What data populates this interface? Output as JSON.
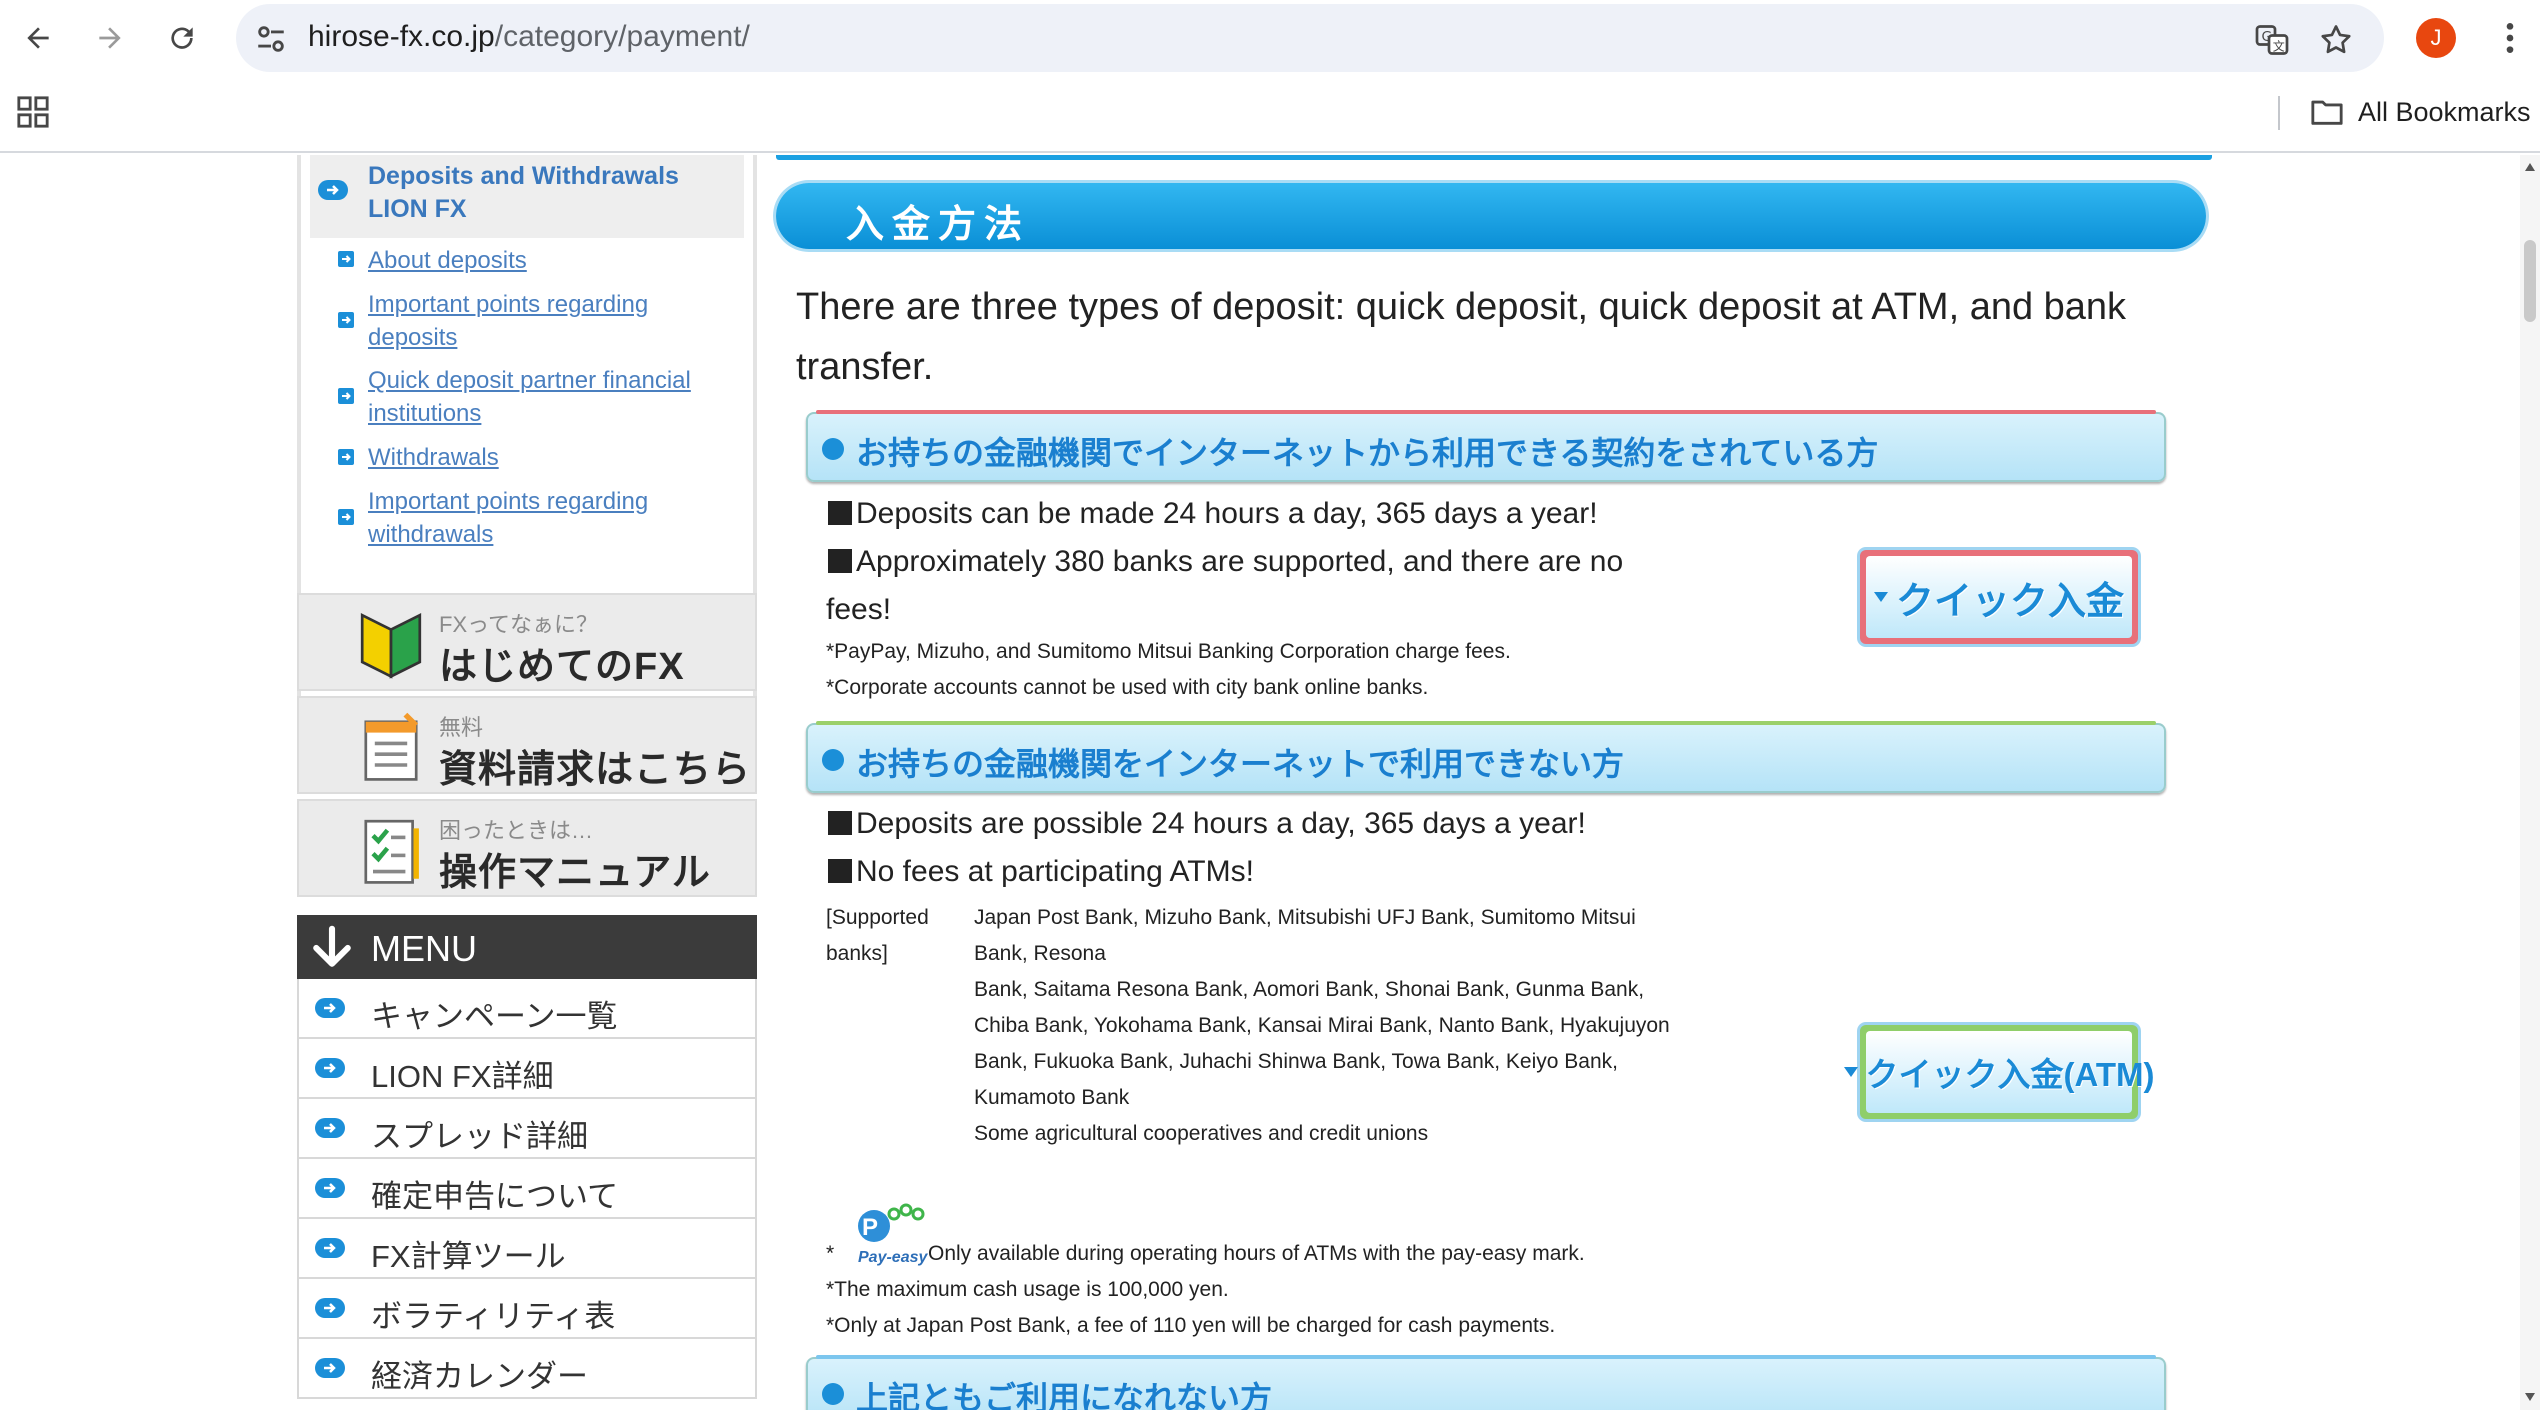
{
  "browser": {
    "url_host": "hirose-fx.co.jp",
    "url_path": "/category/payment/",
    "avatar_letter": "J",
    "bookmarks_label": "All Bookmarks"
  },
  "sidebar": {
    "active_heading": "Deposits and Withdrawals LION FX",
    "links": [
      "About deposits",
      "Important points regarding deposits",
      "Quick deposit partner financial institutions",
      "Withdrawals",
      "Important points regarding withdrawals"
    ],
    "banners": [
      {
        "small": "FXってなぁに？",
        "big": "はじめてのFX",
        "icon": "beginner-mark-icon"
      },
      {
        "small": "無料",
        "big": "資料請求はこちら",
        "icon": "document-request-icon"
      },
      {
        "small": "困ったときは…",
        "big": "操作マニュアル",
        "icon": "manual-checklist-icon"
      }
    ],
    "menu_title": "MENU",
    "menu_items": [
      "キャンペーン一覧",
      "LION FX詳細",
      "スプレッド詳細",
      "確定申告について",
      "FX計算ツール",
      "ボラティリティ表",
      "経済カレンダー"
    ]
  },
  "main": {
    "title": "入金方法",
    "intro": "There are three types of deposit: quick deposit, quick deposit at ATM, and bank transfer.",
    "section1": {
      "heading": "お持ちの金融機関でインターネットから利用できる契約をされている方",
      "line1": "Deposits can be made 24 hours a day, 365 days a year!",
      "line2a": "Approximately 380 banks are supported, and there are no",
      "line2b": "fees!",
      "note1": "*PayPay, Mizuho, and Sumitomo Mitsui Banking Corporation charge fees.",
      "note2": "*Corporate accounts cannot be used with city bank online banks.",
      "button": "クイック入金"
    },
    "section2": {
      "heading": "お持ちの金融機関をインターネットで利用できない方",
      "line1": "Deposits are possible 24 hours a day, 365 days a year!",
      "line2": "No fees at participating ATMs!",
      "banks_label": "[Supported banks]",
      "banks": [
        "Japan Post Bank, Mizuho Bank, Mitsubishi UFJ Bank, Sumitomo Mitsui Bank, Resona",
        "Bank, Saitama Resona Bank, Aomori Bank, Shonai Bank, Gunma Bank, Chiba Bank, Yokohama Bank, Kansai Mirai Bank, Nanto Bank, Hyakujuyon",
        "Bank, Fukuoka Bank, Juhachi Shinwa Bank, Towa Bank, Keiyo Bank, Kumamoto Bank",
        "Some agricultural cooperatives and credit unions"
      ],
      "payeasy_prefix": "*",
      "payeasy_logo_text": "Pay-easy",
      "note1": "Only available during operating hours of ATMs with the pay-easy mark.",
      "note2": "*The maximum cash usage is 100,000 yen.",
      "note3": "*Only at Japan Post Bank, a fee of 110 yen will be charged for cash payments.",
      "button": "クイック入金(ATM)"
    },
    "section3": {
      "heading": "上記ともご利用になれない方"
    }
  },
  "colors": {
    "accent_blue": "#0a8fd6",
    "link_blue": "#4a7fbf",
    "section1_top": "#e8707a",
    "section2_top": "#9bd06a",
    "section3_top": "#7cc6ee"
  }
}
